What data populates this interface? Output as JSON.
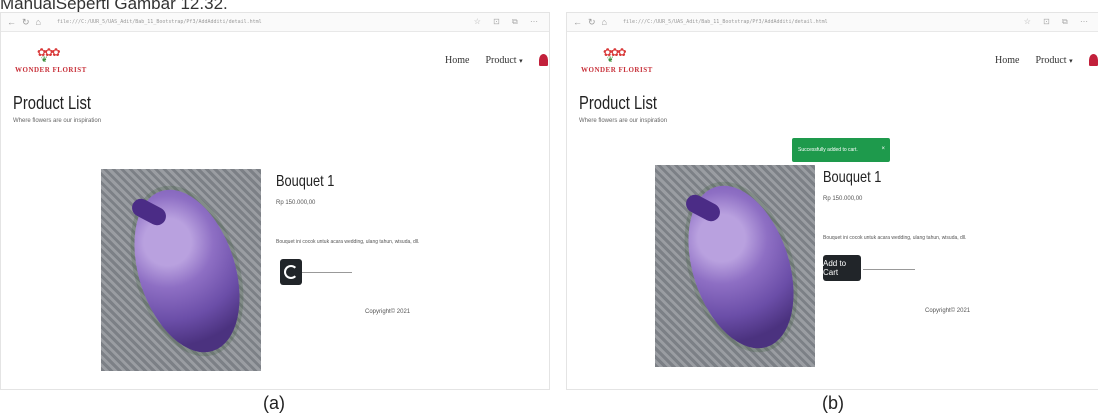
{
  "caption_top": "ManualSeperti Gambar 12.32.",
  "panels": [
    {
      "id": "a",
      "browser": {
        "url": "file:///C:/UUR_5/UAS_Adit/Bab_11_Bootstrap/Pf3/AddAdditi/detail.html"
      },
      "nav": {
        "home": "Home",
        "product": "Product",
        "product_caret": "▾"
      },
      "page": {
        "title": "Product List",
        "subtitle": "Where flowers are our inspiration"
      },
      "product": {
        "name": "Bouquet 1",
        "price": "Rp 150.000,00",
        "description": "Bouquet ini cocok untuk acara wedding, ulang tahun, wisuda, dll."
      },
      "cart_button": {
        "state": "loading"
      },
      "footer": {
        "copyright": "Copyright© 2021"
      },
      "caption": "(a)"
    },
    {
      "id": "b",
      "browser": {
        "url": "file:///C:/UUR_5/UAS_Adit/Bab_11_Bootstrap/Pf3/AddAdditi/detail.html"
      },
      "nav": {
        "home": "Home",
        "product": "Product",
        "product_caret": "▾"
      },
      "page": {
        "title": "Product List",
        "subtitle": "Where flowers are our inspiration"
      },
      "toast": {
        "message": "Successfully added to cart.",
        "close": "×"
      },
      "product": {
        "name": "Bouquet 1",
        "price": "Rp 150.000,00",
        "description": "Bouquet ini cocok untuk acara wedding, ulang tahun, wisuda, dll."
      },
      "cart_button": {
        "label": "Add to Cart"
      },
      "footer": {
        "copyright": "Copyright© 2021"
      },
      "caption": "(b)"
    }
  ],
  "logo": {
    "text": "WONDER FLORIST"
  },
  "colors": {
    "toast_bg": "#1e9a4c",
    "button_bg": "#212529",
    "logo_red": "#c8323b"
  }
}
